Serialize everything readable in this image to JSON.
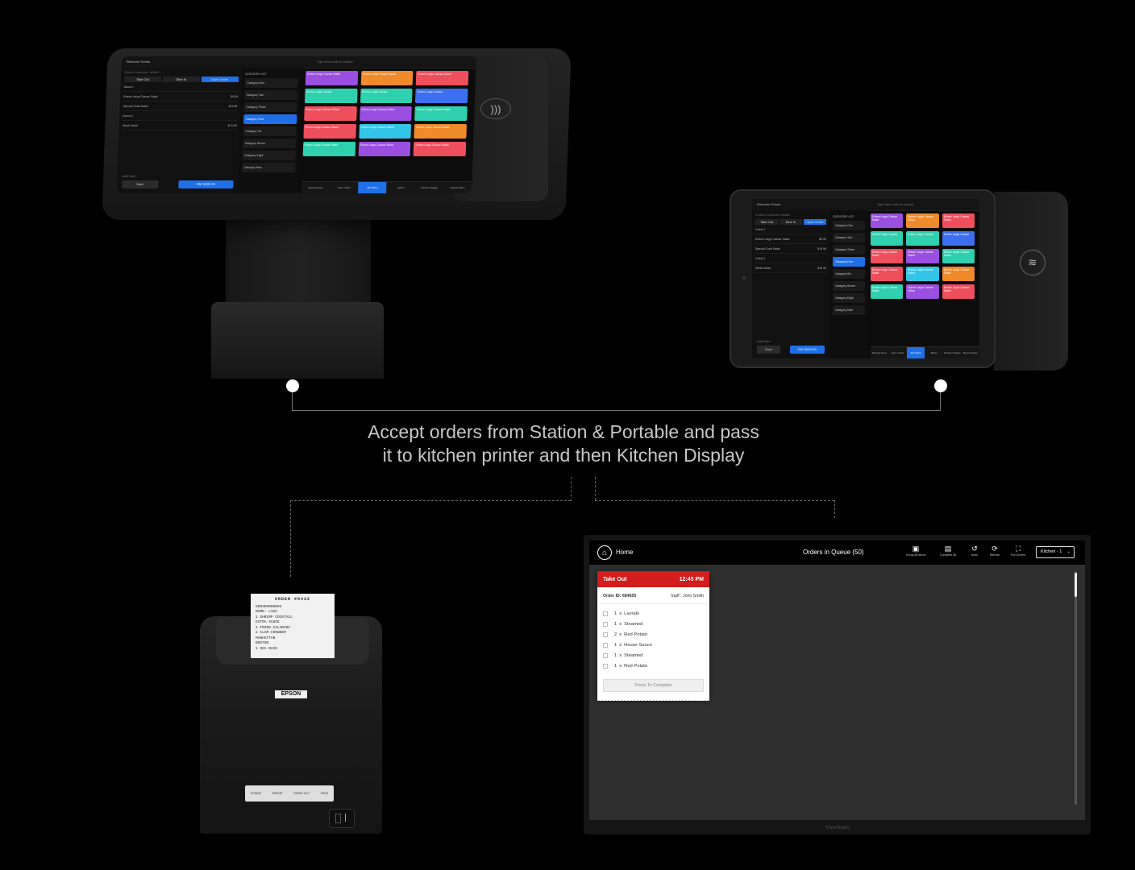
{
  "caption": {
    "line1": "Accept orders from Station & Portable and pass",
    "line2": "it to kitchen printer and then Kitchen Display"
  },
  "pos": {
    "welcome": "Welcome Rohan",
    "search_placeholder": "Type item code or search",
    "customer_search_placeholder": "Search customer details",
    "order_types": [
      "Take Out",
      "Dine In",
      "Open Order"
    ],
    "category_list_label": "CATEGORY LIST",
    "qty_label": "QTY",
    "categories": [
      "Category One",
      "Category Two",
      "Category Three",
      "Category Four",
      "Category Six",
      "Category Seven",
      "Category Eight",
      "Category Nine"
    ],
    "active_category_index": 3,
    "order_lines": [
      {
        "name": "Guest 1",
        "price": ""
      },
      {
        "name": "Entree Large Caesar Salad",
        "price": "$9.99"
      },
      {
        "name": "Special Cobb Salad",
        "price": "$19.99"
      },
      {
        "name": "Guest 2",
        "price": ""
      },
      {
        "name": "Steak Salad",
        "price": "$15.99"
      }
    ],
    "add_note": "Add Note :",
    "save_label": "Save",
    "pay_label": "PAY $220.00",
    "tiles": [
      {
        "label": "Entree Large Caesar Salad",
        "color": "#9a4fe0"
      },
      {
        "label": "Entree Large Caesar Salad",
        "color": "#f08a2a"
      },
      {
        "label": "Entree Large Caesar Salad",
        "color": "#ef4e5d"
      },
      {
        "label": "Entree Large Caesar",
        "color": "#2fd0b0"
      },
      {
        "label": "Entree Large Caesar",
        "color": "#2fd0b0"
      },
      {
        "label": "Entree Large Caesar",
        "color": "#3b6ff0"
      },
      {
        "label": "Entree Large Caesar Salad",
        "color": "#ef4e5d"
      },
      {
        "label": "Entree Large Caesar Salad",
        "color": "#9a4fe0"
      },
      {
        "label": "Entree Large Caesar Salad",
        "color": "#2fd0b0"
      },
      {
        "label": "Entree Large Caesar Salad",
        "color": "#ef4e5d"
      },
      {
        "label": "Entree Large Caesar Salad",
        "color": "#33c5e8"
      },
      {
        "label": "Entree Large Caesar Salad",
        "color": "#f08a2a"
      },
      {
        "label": "Entree Large Caesar Salad",
        "color": "#2fd0b0"
      },
      {
        "label": "Entree Large Caesar Salad",
        "color": "#9a4fe0"
      },
      {
        "label": "Entree Large Caesar Salad",
        "color": "#ef4e5d"
      }
    ],
    "bottom_nav": [
      "Manual Items",
      "Open Order",
      "All Orders",
      "Tables",
      "Kitchen Display",
      "Mixed Orders"
    ],
    "active_nav_index": 2
  },
  "printer": {
    "receipt_header": "ORDER #0432",
    "receipt_lines": [
      "SERVER000004",
      "NAME: LISA",
      "1 SHRIMP COCKTAIL",
      "EXTRA SAUCE",
      "1 FRIED CALAMARI",
      "2 CLAM CHOWDER",
      "MANHATTAN",
      "BOSTON",
      "1 SEA BASS"
    ],
    "brand": "EPSON",
    "panel_labels": [
      "POWER",
      "ERROR",
      "PAPER OUT",
      "FEED"
    ]
  },
  "kds": {
    "home_label": "Home",
    "queue_label": "Orders in Queue (50)",
    "toolbar": [
      {
        "icon": "group-icon",
        "glyph": "▣",
        "label": "Group All Items"
      },
      {
        "icon": "complete-icon",
        "glyph": "▤",
        "label": "Complete All"
      },
      {
        "icon": "undo-icon",
        "glyph": "↺",
        "label": "Undo"
      },
      {
        "icon": "refresh-icon",
        "glyph": "⟳",
        "label": "Refresh"
      },
      {
        "icon": "fullscreen-icon",
        "glyph": "⛶",
        "label": "Full Screen"
      }
    ],
    "kitchen_select": "Kitchen - 1",
    "ticket": {
      "type": "Take Out",
      "time": "12:45 PM",
      "order_id": "Order ID: 684655",
      "staff": "Staff : John Smith",
      "items": [
        {
          "qty": "1",
          "name": "Lavraki"
        },
        {
          "qty": "1",
          "name": "Steamed"
        },
        {
          "qty": "2",
          "name": "Red Potato"
        },
        {
          "qty": "1",
          "name": "House Sauce"
        },
        {
          "qty": "1",
          "name": "Steamed"
        },
        {
          "qty": "1",
          "name": "Red Potato"
        }
      ],
      "complete_label": "Press To Complete",
      "header_color": "#d31d1d"
    },
    "monitor_brand": "ViewSonic"
  }
}
